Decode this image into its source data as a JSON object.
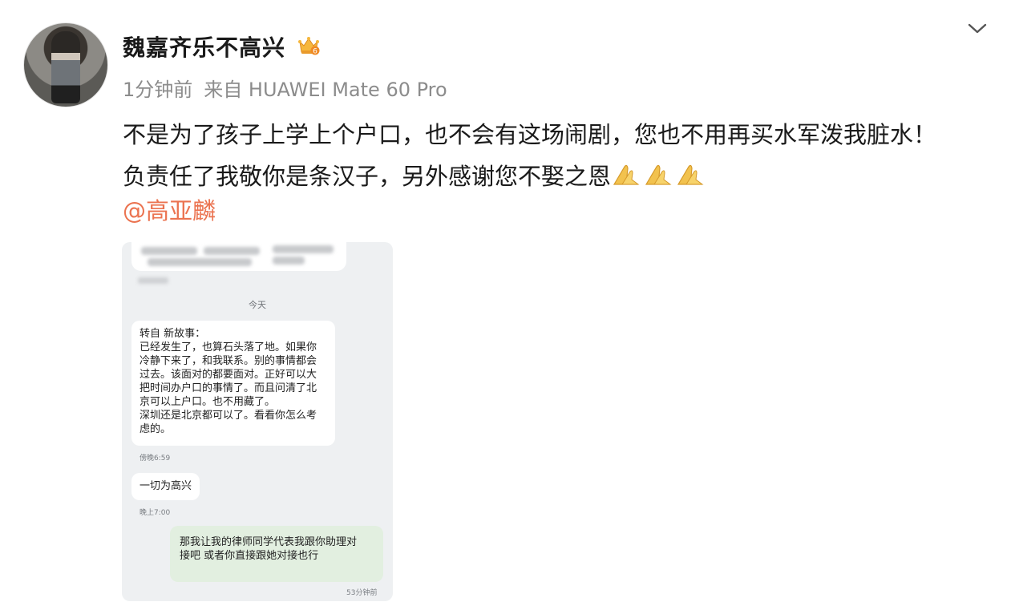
{
  "post": {
    "username": "魏嘉齐乐不高兴",
    "crown_badge_number": "6",
    "time": "1分钟前",
    "source": "来自 HUAWEI Mate 60 Pro",
    "text_lines": [
      "不是为了孩子上学上个户口，也不会有这场闹剧，您也不用再买水军泼我脏水！",
      "负责任了我敬你是条汉子，另外感谢您不娶之恩"
    ],
    "emoji": [
      "pray-emoji",
      "pray-emoji",
      "pray-emoji"
    ],
    "mention": "@高亚麟"
  },
  "chat_screenshot": {
    "date_label": "今天",
    "message_1_lines": [
      "转自 新故事：",
      "已经发生了，也算石头落了地。如果你",
      "冷静下来了，和我联系。别的事情都会",
      "过去。该面对的都要面对。正好可以大",
      "把时间办户口的事情了。而且问清了北",
      "京可以上户口。也不用藏了。",
      "深圳还是北京都可以了。看看你怎么考",
      "虑的。"
    ],
    "message_1_time": "傍晚6:59",
    "message_2": "一切为高兴",
    "message_2_time": "晚上7:00",
    "message_3_lines": [
      "那我让我的律师同学代表我跟你助理对",
      "接吧 或者你直接跟她对接也行"
    ],
    "message_3_time": "53分钟前"
  },
  "colors": {
    "mention": "#eb7350",
    "meta_gray": "#8c8c8c",
    "sent_bubble": "#e2efe0"
  }
}
